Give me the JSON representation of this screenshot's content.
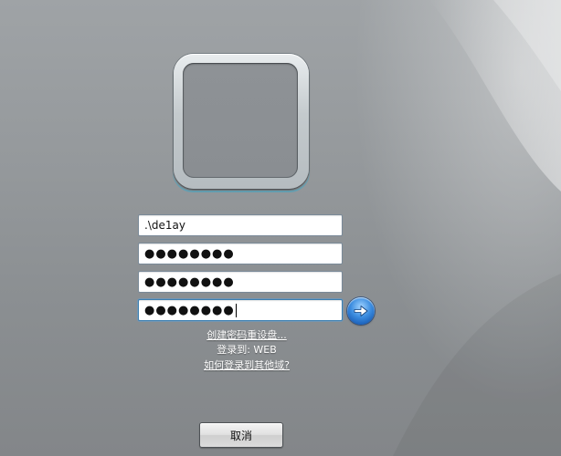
{
  "login": {
    "username": ".\\de1ay",
    "password": "●●●●●●●●",
    "new_password": "●●●●●●●●",
    "confirm_password": "●●●●●●●●"
  },
  "links": {
    "create_reset_disk": "创建密码重设盘...",
    "logon_to": "登录到: WEB",
    "other_domain": "如何登录到其他域?"
  },
  "buttons": {
    "cancel": "取消",
    "submit_icon": "right-arrow-icon"
  },
  "theme": {
    "accent": "#3c8de0",
    "field_border": "#7a8a99",
    "link_color": "#ffffff"
  }
}
